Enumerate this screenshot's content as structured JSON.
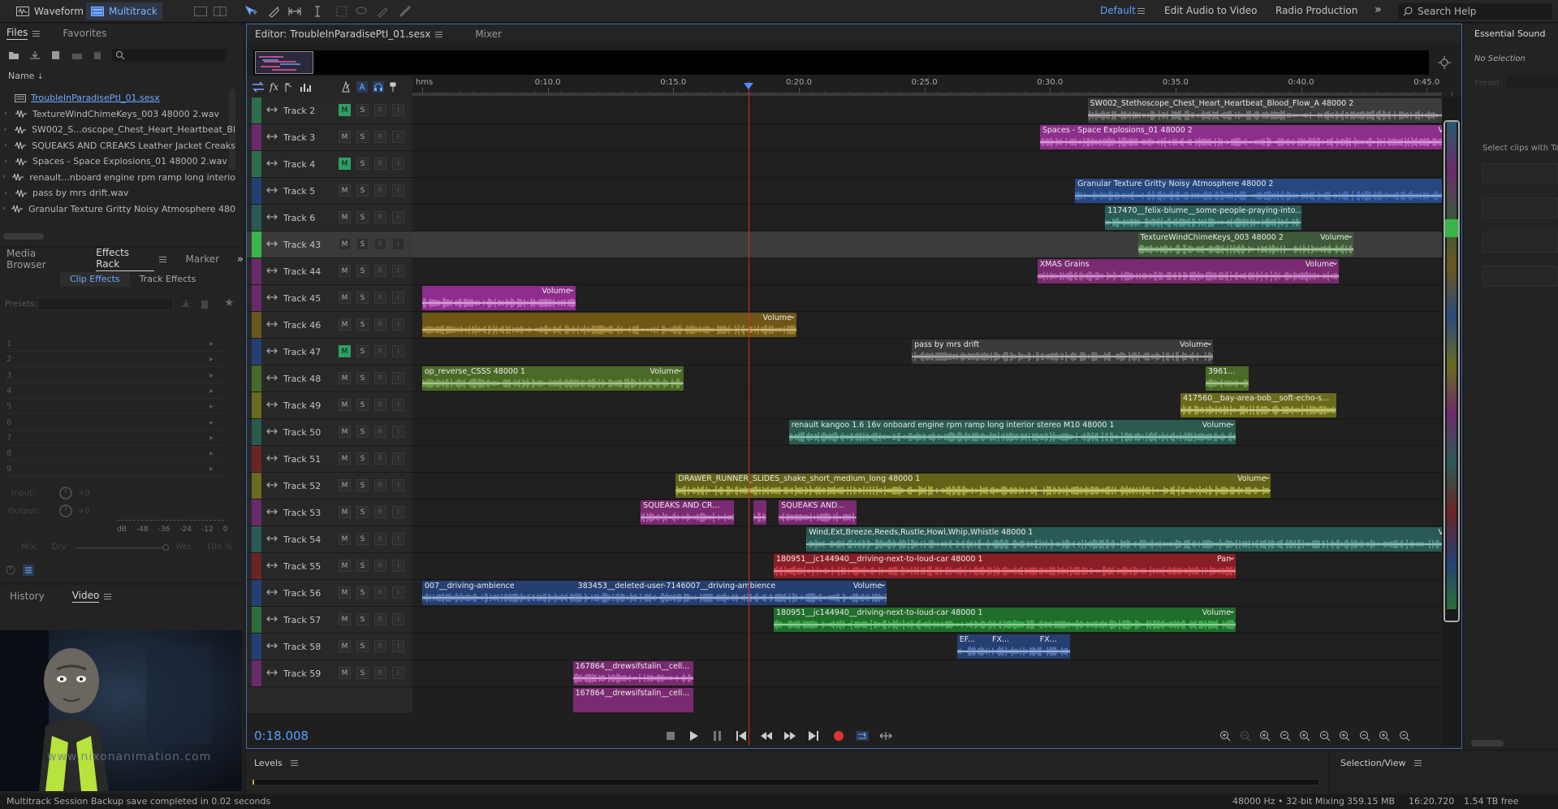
{
  "topbar": {
    "modes": [
      {
        "label": "Waveform",
        "active": false
      },
      {
        "label": "Multitrack",
        "active": true
      }
    ],
    "workspaces": [
      {
        "label": "Default",
        "active": true
      },
      {
        "label": "Edit Audio to Video",
        "active": false
      },
      {
        "label": "Radio Production",
        "active": false
      }
    ],
    "search_placeholder": "Search Help"
  },
  "files_panel": {
    "tabs": [
      "Files",
      "Favorites"
    ],
    "column_header": "Name",
    "items": [
      {
        "name": "TroubleInParadisePtI_01.sesx",
        "session": true
      },
      {
        "name": "TextureWindChimeKeys_003 48000 2.wav"
      },
      {
        "name": "SW002_S...oscope_Chest_Heart_Heartbeat_Bl"
      },
      {
        "name": "SQUEAKS AND CREAKS Leather Jacket Creaks"
      },
      {
        "name": "Spaces - Space Explosions_01 48000 2.wav"
      },
      {
        "name": "renault...nboard engine rpm ramp long interio"
      },
      {
        "name": "pass by mrs drift.wav"
      },
      {
        "name": "Granular Texture Gritty Noisy Atmosphere 480"
      }
    ]
  },
  "effects_panel": {
    "tabs": [
      "Media Browser",
      "Effects Rack",
      "Marker"
    ],
    "subtabs": [
      "Clip Effects",
      "Track Effects"
    ],
    "presets_label": "Presets:",
    "slots": [
      "1",
      "2",
      "3",
      "4",
      "5",
      "6",
      "7",
      "8",
      "9"
    ],
    "input_label": "Input:",
    "input_value": "+0",
    "output_label": "Output:",
    "output_value": "+0",
    "db_ticks": [
      "dB",
      "-48",
      "-36",
      "-24",
      "-12",
      "0"
    ],
    "mix_label": "Mix:",
    "dry_label": "Dry",
    "wet_label": "Wet",
    "mix_value": "100 %"
  },
  "video_panel": {
    "tabs": [
      "History",
      "Video"
    ],
    "watermark": "www.nixonanimation.com"
  },
  "editor": {
    "tabs": [
      {
        "label": "Editor: TroubleInParadisePtI_01.sesx",
        "active": true
      },
      {
        "label": "Mixer",
        "active": false
      }
    ],
    "timecode": "0:18.008",
    "ruler_labels": [
      "hms",
      "0:10.0",
      "0:15.0",
      "0:20.0",
      "0:25.0",
      "0:30.0",
      "0:35.0",
      "0:40.0",
      "0:45.0"
    ],
    "playhead_seconds": 18.008,
    "track_button_labels": {
      "mute": "M",
      "solo": "S",
      "record": "R",
      "input": "I"
    },
    "tracks": [
      {
        "name": "Track 2",
        "color": "#2c6e4e",
        "mute_on": true,
        "clips": [
          {
            "name": "SW002_Stethoscope_Chest_Heart_Heartbeat_Blood_Flow_A 48000 2",
            "vol": "",
            "start": 31.5,
            "end": 47.5,
            "color": "#3c3c3c",
            "wave": "#a0a0a0"
          }
        ]
      },
      {
        "name": "Track 3",
        "color": "#6a2a6a",
        "mute_on": false,
        "clips": [
          {
            "name": "Spaces - Space Explosions_01 48000 2",
            "vol": "Volume",
            "start": 29.6,
            "end": 46.8,
            "color": "#8c2e8c",
            "wave": "#e486e4"
          }
        ]
      },
      {
        "name": "Track 4",
        "color": "#2c6e4e",
        "mute_on": true,
        "clips": []
      },
      {
        "name": "Track 5",
        "color": "#253f73",
        "mute_on": false,
        "clips": [
          {
            "name": "Granular Texture Gritty Noisy Atmosphere 48000 2",
            "vol": "",
            "start": 31.0,
            "end": 47.5,
            "color": "#26477f",
            "wave": "#5a8fe0"
          }
        ]
      },
      {
        "name": "Track 6",
        "color": "#2a5a55",
        "mute_on": false,
        "clips": [
          {
            "name": "117470__felix-blume__some-people-praying-into...",
            "vol": "",
            "start": 32.2,
            "end": 40.0,
            "color": "#2a5d57",
            "wave": "#6fc2b5"
          }
        ]
      },
      {
        "name": "Track 43",
        "color": "#39b54a",
        "mute_on": false,
        "selected": true,
        "clips": [
          {
            "name": "TextureWindChimeKeys_003 48000 2",
            "vol": "Volume",
            "start": 33.5,
            "end": 42.1,
            "color": "#3e5a3a",
            "wave": "#9bd18c"
          }
        ]
      },
      {
        "name": "Track 44",
        "color": "#6a2a6a",
        "mute_on": false,
        "clips": [
          {
            "name": "XMAS Grains",
            "vol": "Volume",
            "start": 29.5,
            "end": 41.5,
            "color": "#7a2a72",
            "wave": "#d77fd0"
          }
        ]
      },
      {
        "name": "Track 45",
        "color": "#6a2a6a",
        "mute_on": false,
        "clips": [
          {
            "name": "",
            "vol": "Volume",
            "start": 5.0,
            "end": 11.1,
            "color": "#8e2d8e",
            "wave": "#e48ee4"
          }
        ]
      },
      {
        "name": "Track 46",
        "color": "#6a5620",
        "mute_on": false,
        "clips": [
          {
            "name": "",
            "vol": "Volume",
            "start": 5.0,
            "end": 19.9,
            "color": "#6e5617",
            "wave": "#cfa94a"
          }
        ]
      },
      {
        "name": "Track 47",
        "color": "#253f73",
        "mute_on": true,
        "clips": [
          {
            "name": "pass by mrs drift",
            "vol": "Volume",
            "start": 24.5,
            "end": 36.5,
            "color": "#3a3a3a",
            "wave": "#9a9a9a"
          }
        ]
      },
      {
        "name": "Track 48",
        "color": "#466a2a",
        "mute_on": false,
        "clips": [
          {
            "name": "op_reverse_CSSS 48000 1",
            "vol": "Volume",
            "start": 5.0,
            "end": 15.4,
            "color": "#4a6a28",
            "wave": "#9bc866"
          },
          {
            "name": "3961...",
            "vol": "",
            "start": 36.2,
            "end": 37.9,
            "color": "#4a6a28",
            "wave": "#9bc866"
          }
        ]
      },
      {
        "name": "Track 49",
        "color": "#6a6a20",
        "mute_on": false,
        "clips": [
          {
            "name": "417560__bay-area-bob__soft-echo-s...",
            "vol": "",
            "start": 35.2,
            "end": 41.4,
            "color": "#6a6a1c",
            "wave": "#d8d860"
          }
        ]
      },
      {
        "name": "Track 50",
        "color": "#2a5a50",
        "mute_on": false,
        "clips": [
          {
            "name": "renault kangoo 1.6 16v onboard engine rpm ramp long interior stereo M10 48000 1",
            "vol": "Volume",
            "start": 19.6,
            "end": 37.4,
            "color": "#2a5a50",
            "wave": "#6ec4a8"
          }
        ]
      },
      {
        "name": "Track 51",
        "color": "#6a2525",
        "mute_on": false,
        "clips": []
      },
      {
        "name": "Track 52",
        "color": "#6a6a20",
        "mute_on": false,
        "clips": [
          {
            "name": "DRAWER_RUNNER_SLIDES_shake_short_medium_long 48000 1",
            "vol": "Volume",
            "start": 15.1,
            "end": 38.8,
            "color": "#626218",
            "wave": "#e0e050"
          }
        ]
      },
      {
        "name": "Track 53",
        "color": "#6a2a6a",
        "mute_on": false,
        "clips": [
          {
            "name": "SQUEAKS AND CR...",
            "vol": "",
            "start": 13.7,
            "end": 17.4,
            "color": "#7a2a72",
            "wave": "#e486e4"
          },
          {
            "name": "",
            "vol": "",
            "start": 18.2,
            "end": 18.7,
            "color": "#7a2a72",
            "wave": "#e486e4"
          },
          {
            "name": "SQUEAKS AND...",
            "vol": "",
            "start": 19.2,
            "end": 22.3,
            "color": "#7a2a72",
            "wave": "#e486e4"
          }
        ]
      },
      {
        "name": "Track 54",
        "color": "#2a5a55",
        "mute_on": false,
        "clips": [
          {
            "name": "Wind,Ext,Breeze,Reeds,Rustle,Howl,Whip,Whistle 48000 1",
            "vol": "Volume",
            "start": 20.3,
            "end": 46.8,
            "color": "#2a5a55",
            "wave": "#6fc2b5"
          }
        ]
      },
      {
        "name": "Track 55",
        "color": "#6a2525",
        "mute_on": false,
        "clips": [
          {
            "name": "180951__jc144940__driving-next-to-loud-car 48000 1",
            "vol": "Pan",
            "start": 19.0,
            "end": 37.4,
            "color": "#8a1e26",
            "wave": "#ff5060"
          }
        ]
      },
      {
        "name": "Track 56",
        "color": "#253f73",
        "mute_on": false,
        "clips": [
          {
            "name": "007__driving-ambience",
            "vol": "",
            "start": 5.0,
            "end": 11.1,
            "color": "#263f72",
            "wave": "#7aa0e8"
          },
          {
            "name": "383453__deleted-user-7146007__driving-ambience",
            "vol": "Volume",
            "start": 11.1,
            "end": 23.5,
            "color": "#263f72",
            "wave": "#7aa0e8"
          }
        ]
      },
      {
        "name": "Track 57",
        "color": "#2c6e3a",
        "mute_on": false,
        "clips": [
          {
            "name": "180951__jc144940__driving-next-to-loud-car 48000 1",
            "vol": "Volume",
            "start": 19.0,
            "end": 37.4,
            "color": "#1f6e2a",
            "wave": "#5fe070"
          }
        ]
      },
      {
        "name": "Track 58",
        "color": "#253f73",
        "mute_on": false,
        "clips": [
          {
            "name": "EF...",
            "vol": "",
            "start": 26.3,
            "end": 27.6,
            "color": "#263f72",
            "wave": "#7aa0e8"
          },
          {
            "name": "FX...",
            "vol": "",
            "start": 27.6,
            "end": 29.5,
            "color": "#263f72",
            "wave": "#7aa0e8"
          },
          {
            "name": "FX...",
            "vol": "",
            "start": 29.5,
            "end": 30.8,
            "color": "#263f72",
            "wave": "#7aa0e8"
          }
        ]
      },
      {
        "name": "Track 59",
        "color": "#6a2a6a",
        "mute_on": false,
        "clips": [
          {
            "name": "167864__drewsifstalin__cell...",
            "vol": "",
            "start": 11.0,
            "end": 15.8,
            "color": "#7a2a72",
            "wave": "#e486e4"
          }
        ]
      }
    ],
    "partial_clip": {
      "name": "167864__drewsifstalin__cell...",
      "start": 11.0,
      "end": 15.8
    }
  },
  "levels_panel": {
    "title": "Levels"
  },
  "selection_panel": {
    "title": "Selection/View"
  },
  "essential_sound": {
    "title": "Essential Sound",
    "no_selection": "No Selection",
    "preset_label": "Preset:",
    "hint": "Select clips with Ta"
  },
  "statusbar": {
    "message": "Multitrack Session Backup save completed in 0.02 seconds",
    "sample_rate": "48000 Hz • 32-bit Mixing",
    "memory": "359.15 MB",
    "duration": "16:20.720",
    "free": "1.54 TB free"
  },
  "colors": {
    "accent": "#3d8bff",
    "playhead": "#d42b2b",
    "record": "#e03535"
  }
}
